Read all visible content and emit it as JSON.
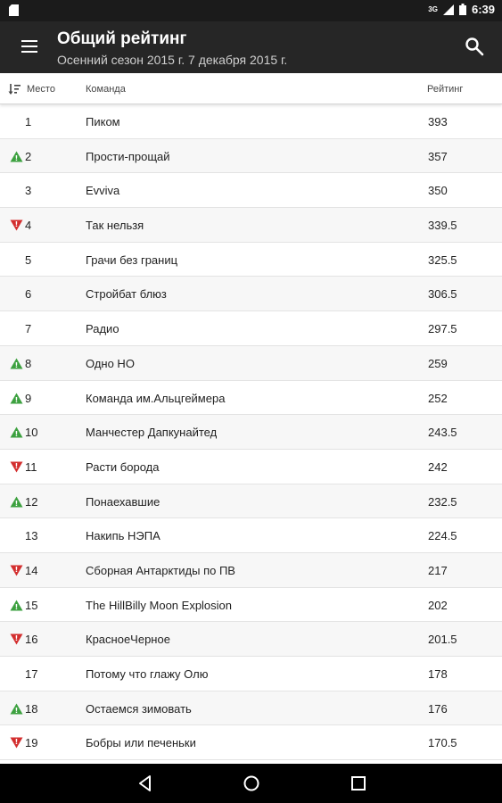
{
  "status_bar": {
    "time": "6:39",
    "network": "3G"
  },
  "app_bar": {
    "title": "Общий рейтинг",
    "subtitle": "Осенний сезон 2015 г. 7 декабря 2015 г."
  },
  "table": {
    "headers": {
      "place": "Место",
      "team": "Команда",
      "rating": "Рейтинг"
    },
    "rows": [
      {
        "place": "1",
        "team": "Пиком",
        "rating": "393",
        "trend": "none"
      },
      {
        "place": "2",
        "team": "Прости-прощай",
        "rating": "357",
        "trend": "up"
      },
      {
        "place": "3",
        "team": "Evviva",
        "rating": "350",
        "trend": "none"
      },
      {
        "place": "4",
        "team": "Так нельзя",
        "rating": "339.5",
        "trend": "down"
      },
      {
        "place": "5",
        "team": "Грачи без границ",
        "rating": "325.5",
        "trend": "none"
      },
      {
        "place": "6",
        "team": "Стройбат блюз",
        "rating": "306.5",
        "trend": "none"
      },
      {
        "place": "7",
        "team": "Радио",
        "rating": "297.5",
        "trend": "none"
      },
      {
        "place": "8",
        "team": "Одно НО",
        "rating": "259",
        "trend": "up"
      },
      {
        "place": "9",
        "team": "Команда им.Альцгеймера",
        "rating": "252",
        "trend": "up"
      },
      {
        "place": "10",
        "team": "Манчестер Дапкунайтед",
        "rating": "243.5",
        "trend": "up"
      },
      {
        "place": "11",
        "team": "Расти борода",
        "rating": "242",
        "trend": "down"
      },
      {
        "place": "12",
        "team": "Понаехавшие",
        "rating": "232.5",
        "trend": "up"
      },
      {
        "place": "13",
        "team": "Накипь НЭПА",
        "rating": "224.5",
        "trend": "none"
      },
      {
        "place": "14",
        "team": "Сборная Антарктиды по ПВ",
        "rating": "217",
        "trend": "down"
      },
      {
        "place": "15",
        "team": "The HillBilly Moon Explosion",
        "rating": "202",
        "trend": "up"
      },
      {
        "place": "16",
        "team": "КрасноеЧерное",
        "rating": "201.5",
        "trend": "down"
      },
      {
        "place": "17",
        "team": "Потому что глажу Олю",
        "rating": "178",
        "trend": "none"
      },
      {
        "place": "18",
        "team": "Остаемся зимовать",
        "rating": "176",
        "trend": "up"
      },
      {
        "place": "19",
        "team": "Бобры или печеньки",
        "rating": "170.5",
        "trend": "down"
      }
    ]
  },
  "colors": {
    "up": "#3da140",
    "down": "#d32f2f",
    "app_bar": "#262626"
  },
  "icons": {
    "menu": "menu-icon",
    "search": "search-icon",
    "sort": "sort-icon"
  }
}
